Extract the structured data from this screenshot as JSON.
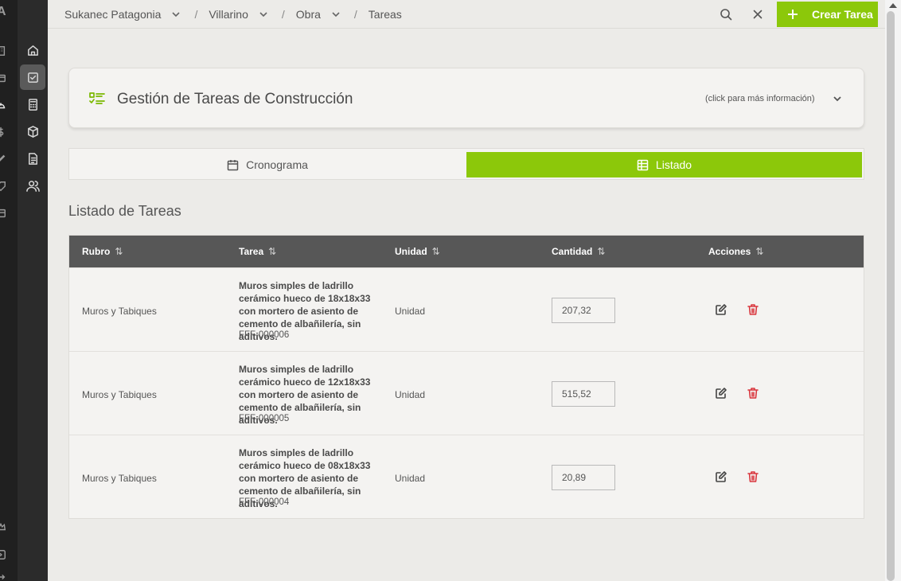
{
  "app": {
    "logo": "A"
  },
  "breadcrumb": {
    "items": [
      {
        "label": "Sukanec Patagonia",
        "has_dropdown": true
      },
      {
        "label": "Villarino",
        "has_dropdown": true
      },
      {
        "label": "Obra",
        "has_dropdown": true
      },
      {
        "label": "Tareas",
        "has_dropdown": false
      }
    ],
    "separator": "/"
  },
  "toolbar": {
    "create_label": "Crear Tarea",
    "accent_color": "#8cc80a"
  },
  "sidebar": {
    "items": [
      {
        "icon": "home-icon",
        "active": false
      },
      {
        "icon": "checkbox-icon",
        "active": true
      },
      {
        "icon": "calculator-icon",
        "active": false
      },
      {
        "icon": "box-icon",
        "active": false
      },
      {
        "icon": "document-icon",
        "active": false
      },
      {
        "icon": "users-icon",
        "active": false
      }
    ]
  },
  "info_card": {
    "title": "Gestión de Tareas de Construcción",
    "more_info": "(click para más información)"
  },
  "views": {
    "cronograma": "Cronograma",
    "listado": "Listado",
    "active": "listado"
  },
  "section_title": "Listado de Tareas",
  "table": {
    "headers": [
      "Rubro",
      "Tarea",
      "Unidad",
      "Cantidad",
      "Acciones"
    ],
    "sort_glyph": "⇅",
    "rows": [
      {
        "rubro": "Muros y Tabiques",
        "tarea": "Muros simples de ladrillo cerámico hueco de 18x18x33 con mortero de asiento de cemento de albañilería, sin aditivos.",
        "code": "FFF-000006",
        "unidad": "Unidad",
        "cantidad": "207,32"
      },
      {
        "rubro": "Muros y Tabiques",
        "tarea": "Muros simples de ladrillo cerámico hueco de 12x18x33 con mortero de asiento de cemento de albañilería, sin aditivos.",
        "code": "FFF-000005",
        "unidad": "Unidad",
        "cantidad": "515,52"
      },
      {
        "rubro": "Muros y Tabiques",
        "tarea": "Muros simples de ladrillo cerámico hueco de 08x18x33 con mortero de asiento de cemento de albañilería, sin aditivos.",
        "code": "FFF-000004",
        "unidad": "Unidad",
        "cantidad": "20,89"
      }
    ]
  }
}
